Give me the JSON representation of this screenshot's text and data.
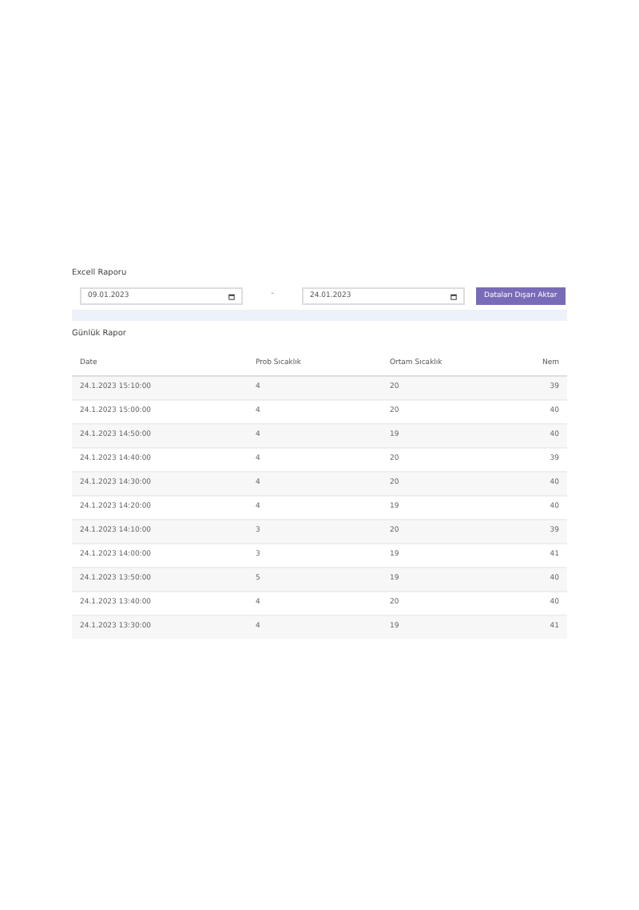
{
  "excel_report": {
    "title": "Excell Raporu",
    "start_date": "09.01.2023",
    "separator": "-",
    "end_date": "24.01.2023",
    "button": "Dataları Dışarı Aktar"
  },
  "daily_report": {
    "title": "Günlük Rapor",
    "columns": [
      "Date",
      "Prob Sıcaklık",
      "Ortam Sıcaklık",
      "Nem"
    ],
    "rows": [
      [
        "24.1.2023 15:10:00",
        "4",
        "20",
        "39"
      ],
      [
        "24.1.2023 15:00:00",
        "4",
        "20",
        "40"
      ],
      [
        "24.1.2023 14:50:00",
        "4",
        "19",
        "40"
      ],
      [
        "24.1.2023 14:40:00",
        "4",
        "20",
        "39"
      ],
      [
        "24.1.2023 14:30:00",
        "4",
        "20",
        "40"
      ],
      [
        "24.1.2023 14:20:00",
        "4",
        "19",
        "40"
      ],
      [
        "24.1.2023 14:10:00",
        "3",
        "20",
        "39"
      ],
      [
        "24.1.2023 14:00:00",
        "3",
        "19",
        "41"
      ],
      [
        "24.1.2023 13:50:00",
        "5",
        "19",
        "40"
      ],
      [
        "24.1.2023 13:40:00",
        "4",
        "20",
        "40"
      ],
      [
        "24.1.2023 13:30:00",
        "4",
        "19",
        "41"
      ]
    ]
  }
}
